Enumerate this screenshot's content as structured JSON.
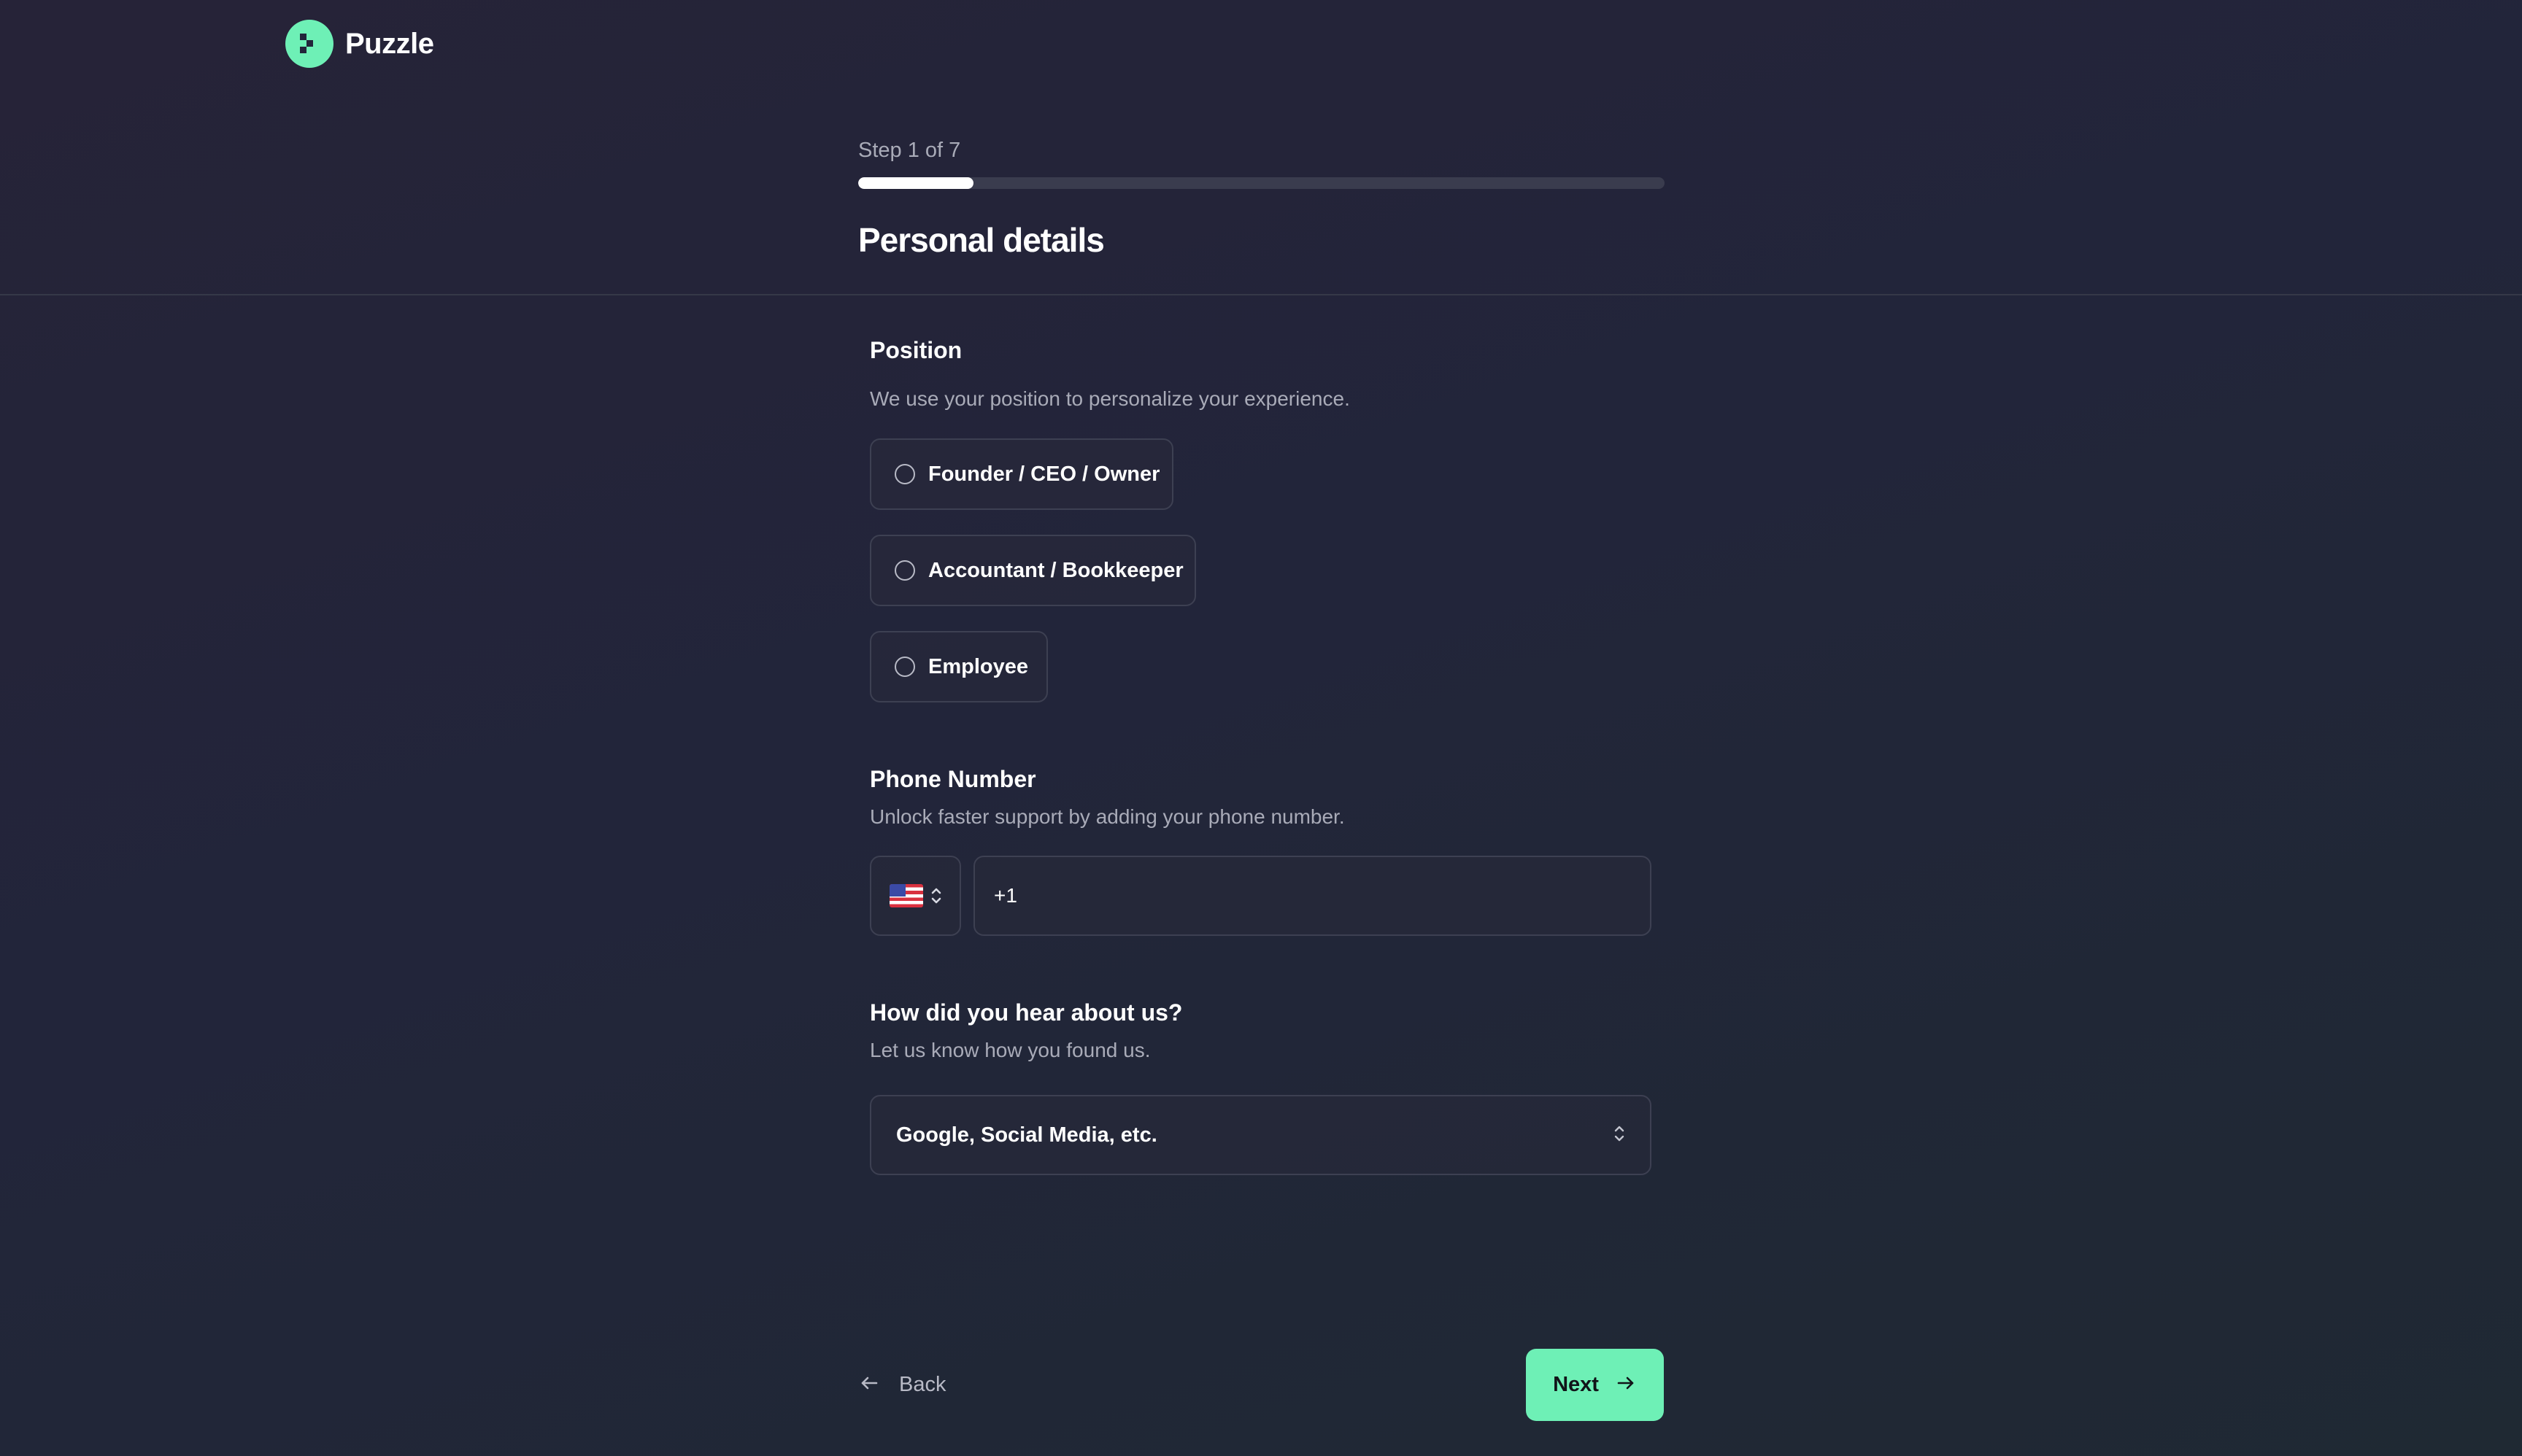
{
  "brand": {
    "name": "Puzzle",
    "accent_color": "#6ef0b6",
    "logo_icon": "puzzle-logo-icon"
  },
  "progress": {
    "label": "Step 1 of 7",
    "current": 1,
    "total": 7
  },
  "page": {
    "title": "Personal details"
  },
  "position": {
    "title": "Position",
    "description": "We use your position to personalize your experience.",
    "options": [
      {
        "label": "Founder / CEO / Owner",
        "selected": false
      },
      {
        "label": "Accountant / Bookkeeper",
        "selected": false
      },
      {
        "label": "Employee",
        "selected": false
      }
    ]
  },
  "phone": {
    "title": "Phone Number",
    "description": "Unlock faster support by adding your phone number.",
    "country_flag_icon": "us-flag-icon",
    "value": "+1"
  },
  "source": {
    "title": "How did you hear about us?",
    "description": "Let us know how you found us.",
    "selected_value": "Google, Social Media, etc."
  },
  "footer": {
    "back_label": "Back",
    "next_label": "Next"
  }
}
